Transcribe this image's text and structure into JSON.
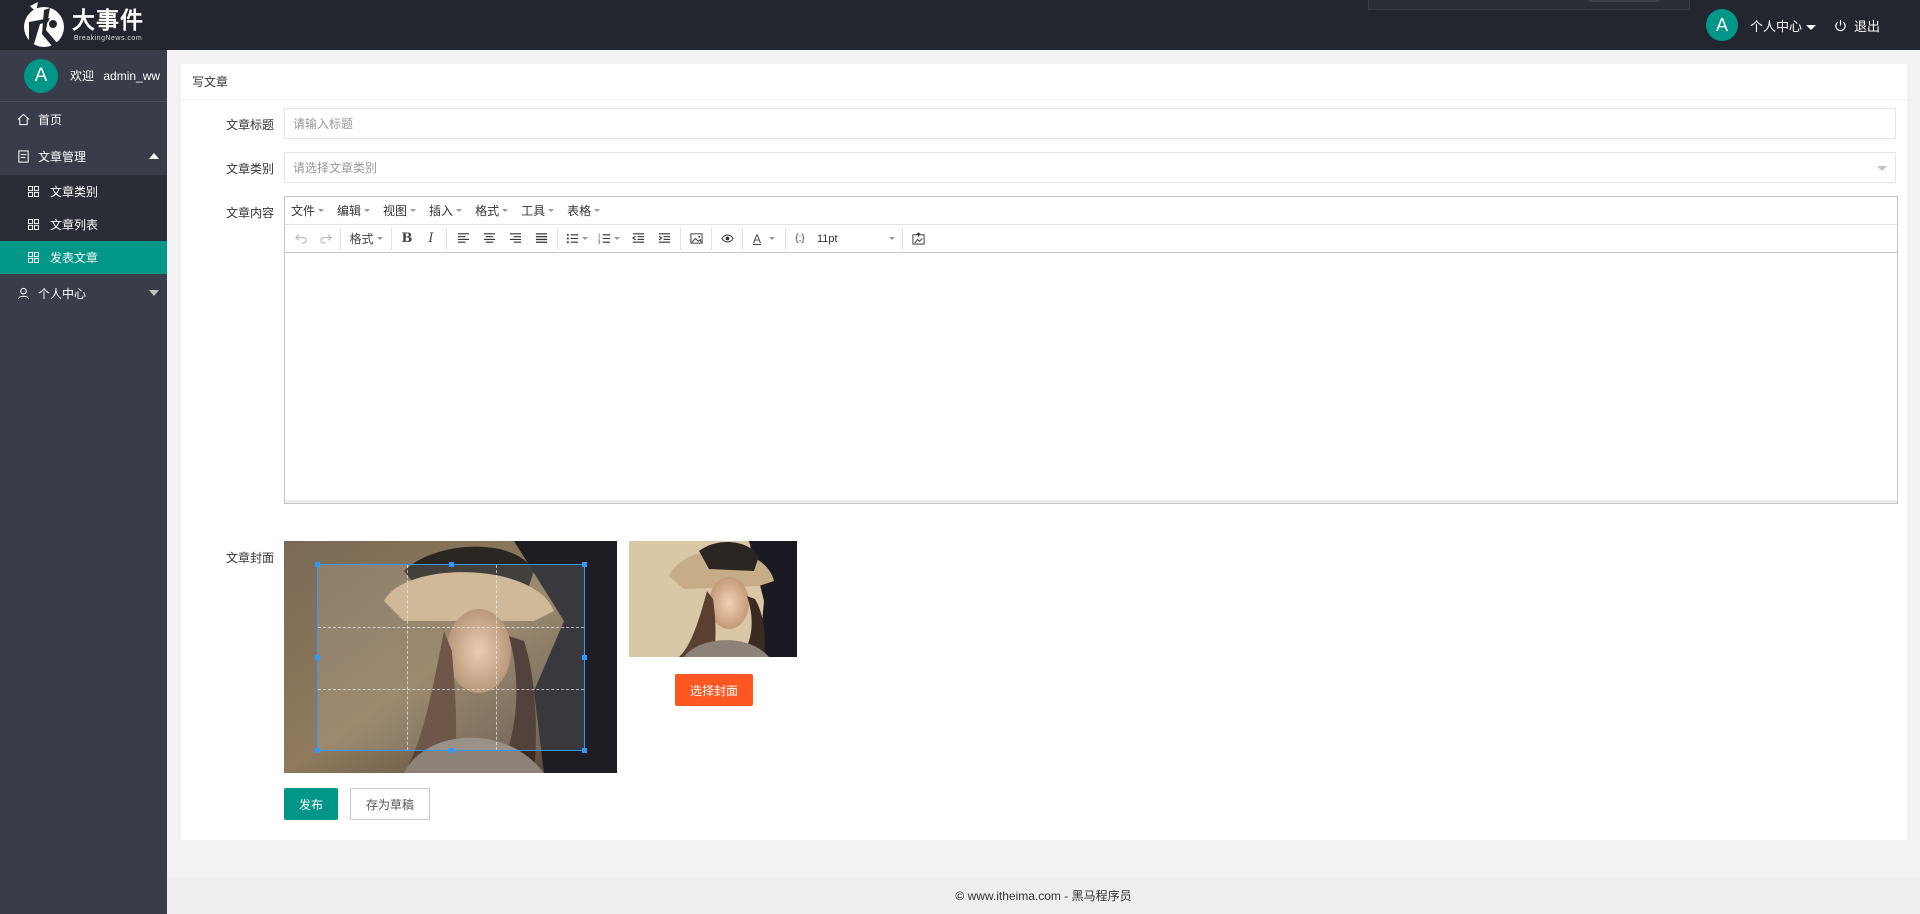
{
  "header": {
    "logo_title": "大事件",
    "logo_sub": "BreakingNews.com",
    "avatar_letter": "A",
    "user_center": "个人中心",
    "logout": "退出"
  },
  "sidebar": {
    "avatar_letter": "A",
    "welcome": "欢迎",
    "username": "admin_ww",
    "items": [
      {
        "label": "首页",
        "icon": "home-icon"
      },
      {
        "label": "文章管理",
        "icon": "article-icon",
        "expanded": true,
        "children": [
          {
            "label": "文章类别",
            "icon": "grid-icon"
          },
          {
            "label": "文章列表",
            "icon": "grid-icon"
          },
          {
            "label": "发表文章",
            "icon": "grid-icon",
            "active": true
          }
        ]
      },
      {
        "label": "个人中心",
        "icon": "user-icon",
        "expanded": false
      }
    ]
  },
  "card": {
    "title": "写文章",
    "fields": {
      "title_label": "文章标题",
      "title_placeholder": "请输入标题",
      "category_label": "文章类别",
      "category_placeholder": "请选择文章类别",
      "content_label": "文章内容",
      "cover_label": "文章封面"
    },
    "editor": {
      "menus": [
        "文件",
        "编辑",
        "视图",
        "插入",
        "格式",
        "工具",
        "表格"
      ],
      "format_label": "格式",
      "font_size": "11pt"
    },
    "buttons": {
      "choose_cover": "选择封面",
      "publish": "发布",
      "save_draft": "存为草稿"
    }
  },
  "footer": {
    "text": "© www.itheima.com - 黑马程序员"
  },
  "colors": {
    "header_bg": "#23262e",
    "sidebar_bg": "#393d49",
    "accent": "#009688",
    "orange": "#ff5722"
  }
}
